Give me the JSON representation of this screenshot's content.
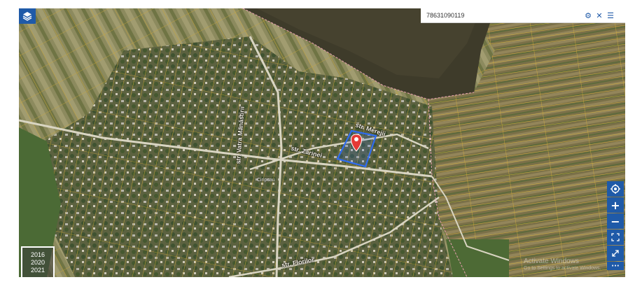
{
  "search": {
    "value": "78631090119"
  },
  "icons": {
    "layers": "layers-icon",
    "settings": "gear-icon",
    "clear": "close-icon",
    "menu": "menu-icon",
    "locate": "locate-icon",
    "zoom_in": "plus-icon",
    "zoom_out": "minus-icon",
    "fullscreen": "expand-icon",
    "shrink": "shrink-icon",
    "more": "more-icon"
  },
  "tools": {
    "zoom_in": "+",
    "zoom_out": "−",
    "more": "···"
  },
  "years": [
    "2016",
    "2020",
    "2021"
  ],
  "streets": {
    "s1": "str. Merejii",
    "s2": "str. Zarinei",
    "s3": "str. Vatra Mănăstirii",
    "s4": "str. Florilor"
  },
  "village": "Ciripcau",
  "watermark": {
    "line1": "Activate Windows",
    "line2": "Go to Settings to activate Windows."
  },
  "colors": {
    "accent": "#1f5aa8",
    "parcel": "#c9a63a",
    "selected_parcel": "#2f6cf0",
    "marker": "#e53935"
  }
}
